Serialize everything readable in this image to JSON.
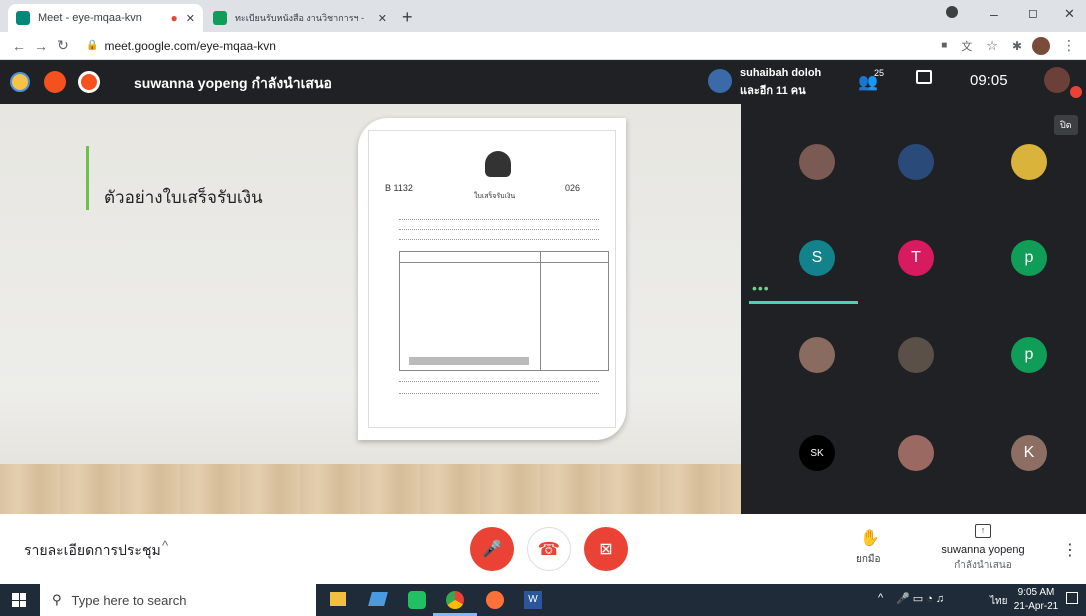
{
  "browser": {
    "tabs": [
      {
        "title": "Meet - eye-mqaa-kvn",
        "close": "✕"
      },
      {
        "title": "ทะเบียนรับหนังสือ งานวิชาการฯ - Goo",
        "close": "✕"
      }
    ],
    "new_tab": "+",
    "url": "meet.google.com/eye-mqaa-kvn",
    "window_controls": [
      "–",
      "◻",
      "✕"
    ]
  },
  "meet_header": {
    "presenter_text": "suwanna yopeng กำลังนำเสนอ",
    "participant_name": "suhaibah doloh",
    "participant_more": "และอีก 11 คน",
    "people_count": "25",
    "time": "09:05"
  },
  "slide": {
    "title": "ตัวอย่างใบเสร็จรับเงิน",
    "receipt_no_left": "B 1132",
    "receipt_no_right": "026",
    "receipt_heading": "ใบเสร็จรับเงิน"
  },
  "grid": {
    "close_label": "ปิด",
    "tiles": [
      {
        "type": "photo",
        "color": "#7a5a52"
      },
      {
        "type": "photo",
        "color": "#2a4a7a"
      },
      {
        "type": "photo",
        "color": "#d9b33a"
      },
      {
        "type": "letter",
        "letter": "S",
        "color": "#12828b"
      },
      {
        "type": "letter",
        "letter": "T",
        "color": "#d81b60"
      },
      {
        "type": "letter",
        "letter": "p",
        "color": "#0f9d58"
      },
      {
        "type": "photo",
        "color": "#8a6b60"
      },
      {
        "type": "photo",
        "color": "#5a5048"
      },
      {
        "type": "letter",
        "letter": "p",
        "color": "#0f9d58"
      },
      {
        "type": "letter",
        "letter": "SK",
        "color": "#000000"
      },
      {
        "type": "photo",
        "color": "#9a6a62"
      },
      {
        "type": "letter",
        "letter": "K",
        "color": "#8d6e63"
      }
    ]
  },
  "controls": {
    "meeting_details": "รายละเอียดการประชุม",
    "raise_hand": "ยกมือ",
    "presenter_line1": "suwanna yopeng",
    "presenter_line2": "กำลังนำเสนอ"
  },
  "taskbar": {
    "search_placeholder": "Type here to search",
    "lang": "ไทย",
    "clock_time": "9:05 AM",
    "clock_date": "21-Apr-21"
  },
  "colors": {
    "red": "#ea4335",
    "meet_dark": "#202124",
    "accent_green": "#6fbf4a"
  }
}
